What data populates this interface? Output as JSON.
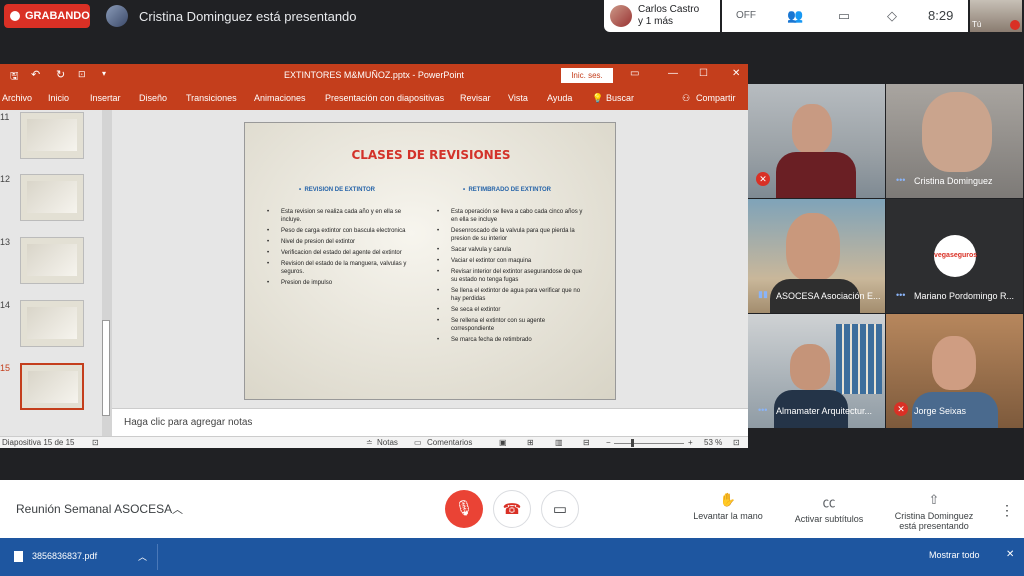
{
  "top": {
    "recording_label": "GRABANDO",
    "presenting_text": "Cristina Dominguez está presentando",
    "caller_name_line1": "Carlos Castro",
    "caller_name_line2": "y 1 más",
    "off_label": "OFF",
    "clock": "8:29",
    "self_label": "Tú"
  },
  "ppt": {
    "window_title": "EXTINTORES M&MUÑOZ.pptx - PowerPoint",
    "signin_label": "Inic. ses.",
    "menu": [
      "Archivo",
      "Inicio",
      "Insertar",
      "Diseño",
      "Transiciones",
      "Animaciones",
      "Presentación con diapositivas",
      "Revisar",
      "Vista",
      "Ayuda",
      "Buscar",
      "Compartir"
    ],
    "thumb_numbers": [
      "11",
      "12",
      "13",
      "14",
      "15"
    ],
    "notes_placeholder": "Haga clic para agregar notas",
    "status_slide": "Diapositiva 15 de 15",
    "status_notes": "Notas",
    "status_comments": "Comentarios",
    "zoom": "53 %"
  },
  "slide": {
    "title": "CLASES DE REVISIONES",
    "left_heading": "REVISION DE EXTINTOR",
    "right_heading": "RETIMBRADO DE EXTINTOR",
    "left_items": [
      "Esta revision se realiza cada año y en ella se incluye.",
      "Peso de carga extintor con bascula electronica",
      "Nivel de presion del extintor",
      "Verificacion del estado del agente del extintor",
      "Revision del estado de la manguera, valvulas y seguros.",
      "Presion de impulso"
    ],
    "right_items": [
      "Esta operación se lleva a cabo cada cinco años y en ella se incluye",
      "Desenroscado de la valvula para que pierda la presion de su interior",
      "Sacar valvula y canula",
      "Vaciar el extintor con maquina",
      "Revisar interior del extintor asegurandose de que su estado no tenga fugas",
      "Se llena el extintor de agua para verificar que no hay perdidas",
      "Se seca el extintor",
      "Se rellena el extintor con su agente correspondiente",
      "Se marca fecha de retimbrado"
    ]
  },
  "tiles": [
    {
      "name": ""
    },
    {
      "name": "Cristina Dominguez"
    },
    {
      "name": "ASOCESA Asociación E..."
    },
    {
      "name": "Mariano Pordomingo R..."
    },
    {
      "name": "Almamater Arquitectur..."
    },
    {
      "name": "Jorge Seixas"
    }
  ],
  "tile_logo_text": "vegaseguros",
  "bottom": {
    "meeting_name": "Reunión Semanal ASOCESA",
    "raise_hand": "Levantar la mano",
    "captions": "Activar subtítulos",
    "presenting_line1": "Cristina Dominguez",
    "presenting_line2": "está presentando"
  },
  "download": {
    "file_name": "3856836837.pdf",
    "show_all": "Mostrar todo"
  },
  "colors": {
    "ppt_accent": "#c43e1c",
    "record_red": "#d93025",
    "download_bar": "#1e56a0"
  }
}
